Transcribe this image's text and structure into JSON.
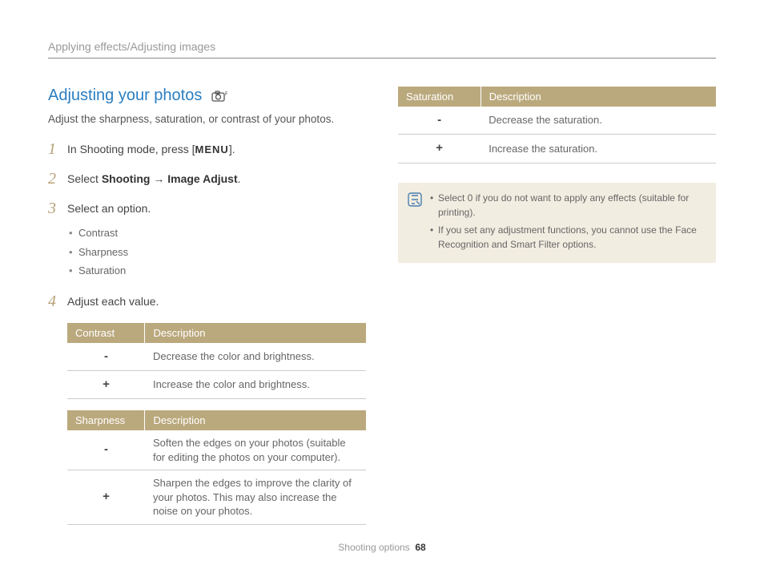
{
  "header": {
    "breadcrumb": "Applying effects/Adjusting images"
  },
  "section": {
    "title": "Adjusting your photos",
    "intro": "Adjust the sharpness, saturation, or contrast of your photos."
  },
  "steps": {
    "s1_pre": "In Shooting mode, press [",
    "s1_menu": "MENU",
    "s1_post": "].",
    "s2_pre": "Select ",
    "s2_b1": "Shooting",
    "s2_arrow": " → ",
    "s2_b2": "Image Adjust",
    "s2_post": ".",
    "s3": "Select an option.",
    "s3_opts": [
      "Contrast",
      "Sharpness",
      "Saturation"
    ],
    "s4": "Adjust each value."
  },
  "tables": {
    "contrast": {
      "h1": "Contrast",
      "h2": "Description",
      "rows": [
        {
          "k": "-",
          "v": "Decrease the color and brightness."
        },
        {
          "k": "+",
          "v": "Increase the color and brightness."
        }
      ]
    },
    "sharpness": {
      "h1": "Sharpness",
      "h2": "Description",
      "rows": [
        {
          "k": "-",
          "v": "Soften the edges on your photos (suitable for editing the photos on your computer)."
        },
        {
          "k": "+",
          "v": "Sharpen the edges to improve the clarity of your photos. This may also increase the noise on your photos."
        }
      ]
    },
    "saturation": {
      "h1": "Saturation",
      "h2": "Description",
      "rows": [
        {
          "k": "-",
          "v": "Decrease the saturation."
        },
        {
          "k": "+",
          "v": "Increase the saturation."
        }
      ]
    }
  },
  "notes": [
    "Select 0 if you do not want to apply any effects (suitable for printing).",
    "If you set any adjustment functions, you cannot use the Face Recognition and Smart Filter options."
  ],
  "footer": {
    "section": "Shooting options",
    "page": "68"
  }
}
